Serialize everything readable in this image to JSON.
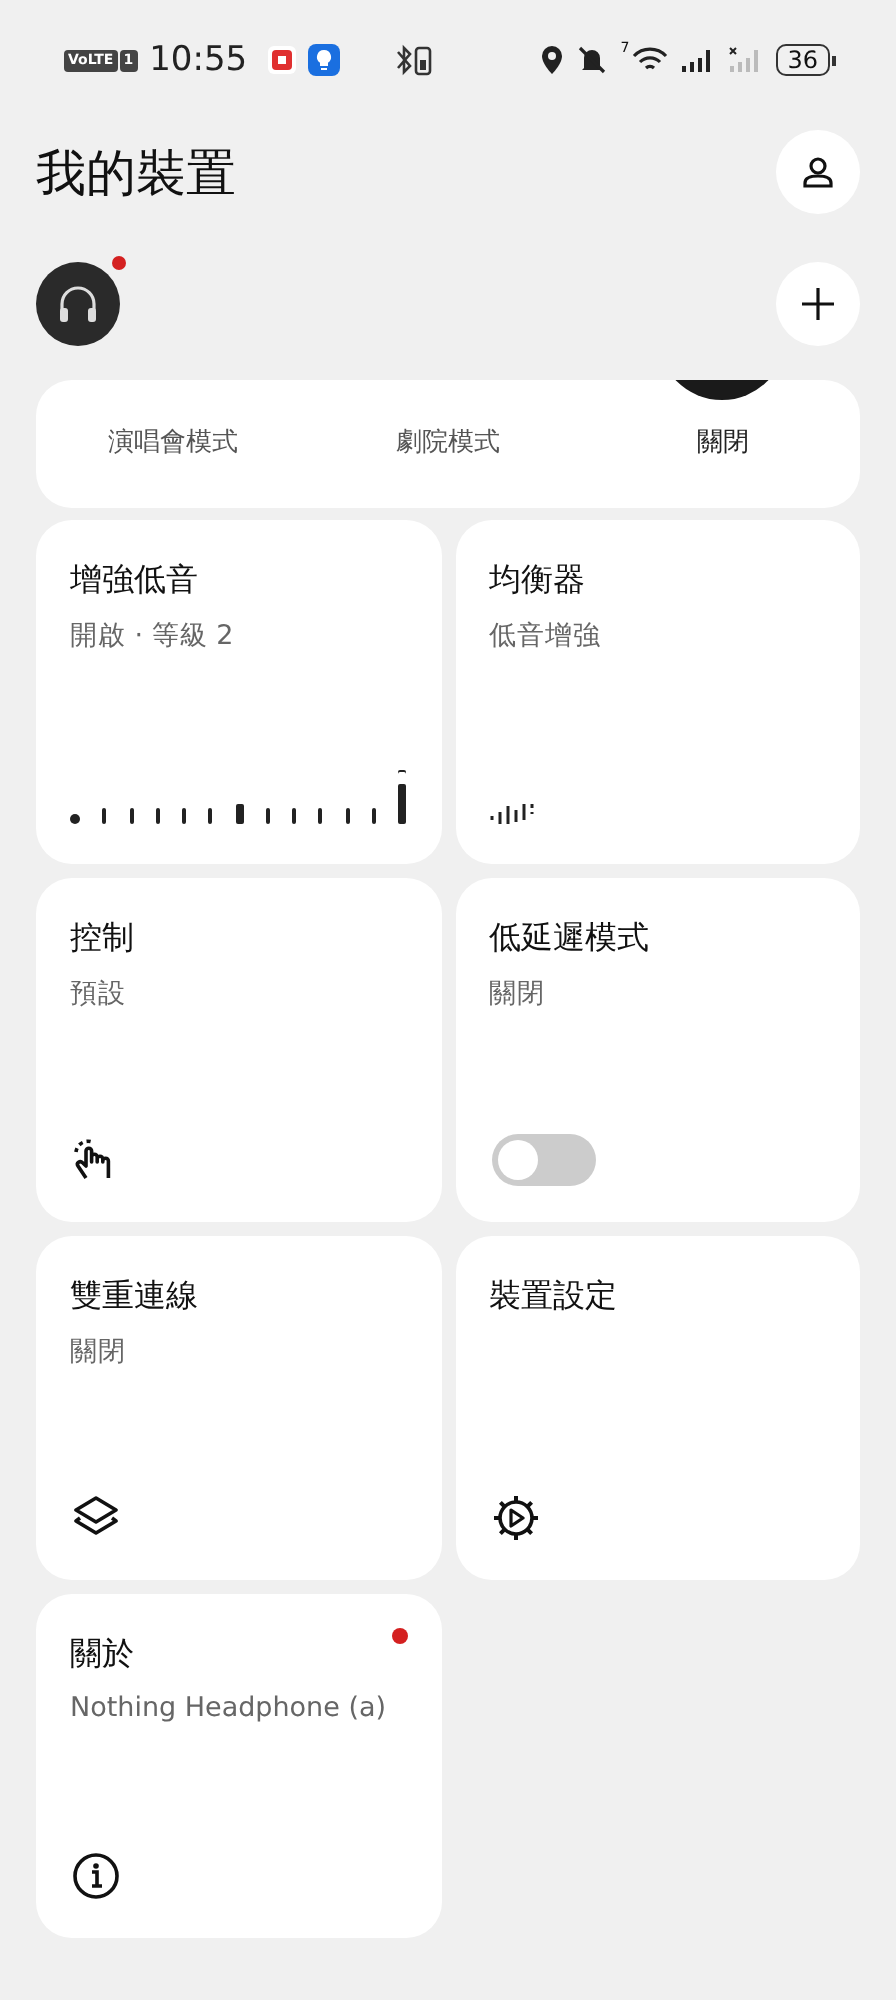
{
  "status_bar": {
    "volte": "VoLTE",
    "sim": "1",
    "time": "10:55",
    "wifi_badge": "7",
    "battery": "36"
  },
  "header": {
    "title": "我的裝置"
  },
  "device": {
    "notification": true
  },
  "modes": [
    {
      "label": "演唱會模式",
      "selected": false
    },
    {
      "label": "劇院模式",
      "selected": false
    },
    {
      "label": "關閉",
      "selected": true
    }
  ],
  "tiles": [
    {
      "kind": "slider",
      "title": "增強低音",
      "subtitle": "開啟 · 等級 2",
      "level": 0.5,
      "dot": false
    },
    {
      "kind": "equalizer",
      "title": "均衡器",
      "subtitle": "低音增強",
      "dot": false
    },
    {
      "kind": "gesture",
      "title": "控制",
      "subtitle": "預設",
      "dot": false
    },
    {
      "kind": "toggle",
      "title": "低延遲模式",
      "subtitle": "關閉",
      "on": false,
      "dot": false
    },
    {
      "kind": "connection",
      "title": "雙重連線",
      "subtitle": "關閉",
      "dot": false
    },
    {
      "kind": "settings",
      "title": "裝置設定",
      "dot": false
    },
    {
      "kind": "about",
      "title": "關於",
      "subtitle": "Nothing Headphone (a)",
      "dot": true
    }
  ]
}
